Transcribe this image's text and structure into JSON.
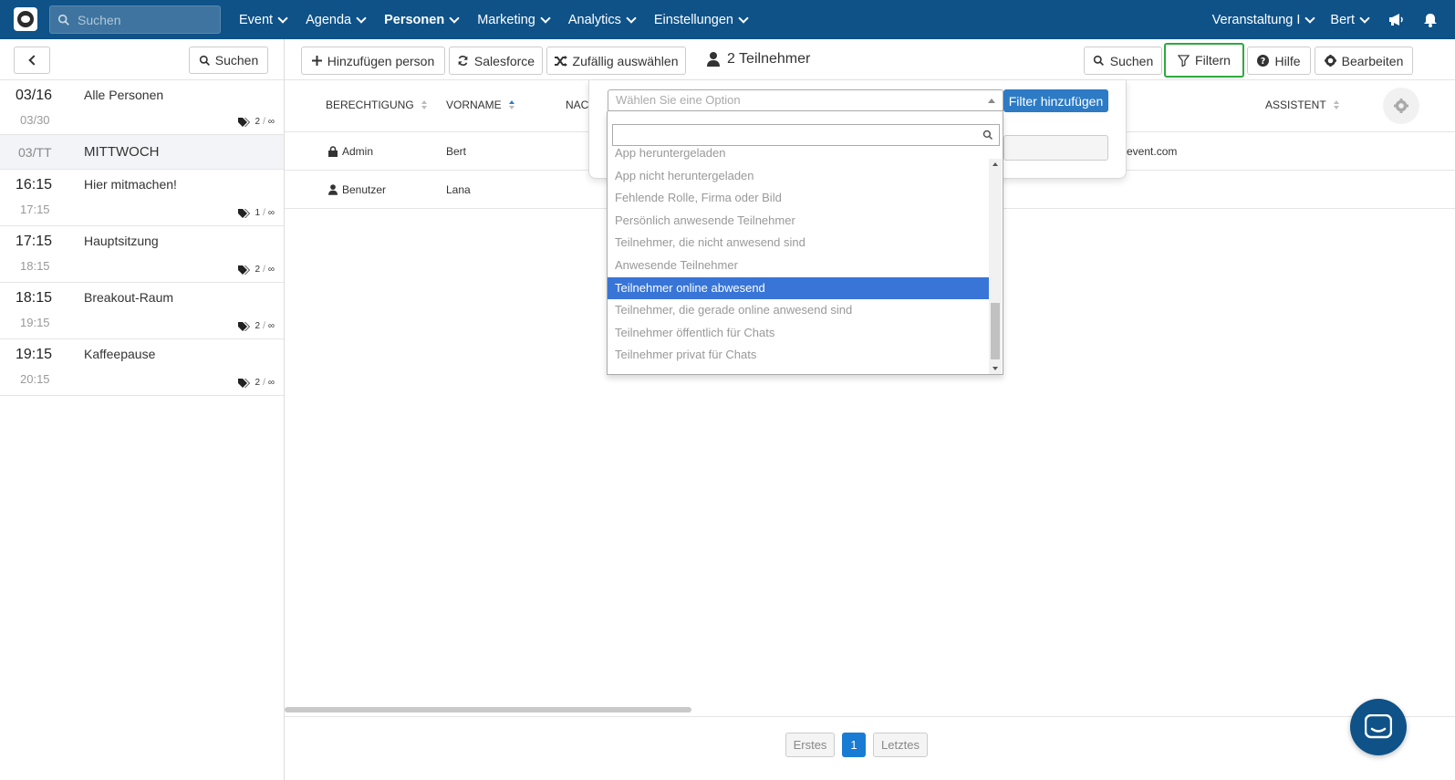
{
  "nav": {
    "search_placeholder": "Suchen",
    "items": [
      {
        "label": "Event",
        "bold": false
      },
      {
        "label": "Agenda",
        "bold": false
      },
      {
        "label": "Personen",
        "bold": true
      },
      {
        "label": "Marketing",
        "bold": false
      },
      {
        "label": "Analytics",
        "bold": false
      },
      {
        "label": "Einstellungen",
        "bold": false
      }
    ],
    "event_selector": "Veranstaltung I",
    "user": "Bert",
    "brand_color": "#0e5288"
  },
  "left": {
    "search_label": "Suchen",
    "sessions": [
      {
        "start": "03/16",
        "end": "03/30",
        "title": "Alle Personen",
        "tag_count": "2",
        "tag_max": "∞",
        "kind": "first"
      },
      {
        "start": "03/TT",
        "title": "MITTWOCH",
        "kind": "day"
      },
      {
        "start": "16:15",
        "end": "17:15",
        "title": "Hier mitmachen!",
        "tag_count": "1",
        "tag_max": "∞",
        "kind": "big"
      },
      {
        "start": "17:15",
        "end": "18:15",
        "title": "Hauptsitzung",
        "tag_count": "2",
        "tag_max": "∞",
        "kind": "big"
      },
      {
        "start": "18:15",
        "end": "19:15",
        "title": "Breakout-Raum",
        "tag_count": "2",
        "tag_max": "∞",
        "kind": "big"
      },
      {
        "start": "19:15",
        "end": "20:15",
        "title": "Kaffeepause",
        "tag_count": "2",
        "tag_max": "∞",
        "kind": "big"
      }
    ]
  },
  "toolbar": {
    "add_person": "Hinzufügen person",
    "salesforce": "Salesforce",
    "random": "Zufällig auswählen",
    "participants_count": "2 Teilnehmer",
    "search": "Suchen",
    "filter": "Filtern",
    "help": "Hilfe",
    "edit": "Bearbeiten",
    "highlight_color": "#2eaa3d"
  },
  "table": {
    "headers": {
      "permission": "BERECHTIGUNG",
      "firstname": "VORNAME",
      "lastname_partial": "NAC",
      "assistant": "ASSISTENT"
    },
    "rows": [
      {
        "permission": "Admin",
        "permission_icon": "lock-icon",
        "firstname": "Bert",
        "email_partial": "event.com"
      },
      {
        "permission": "Benutzer",
        "permission_icon": "user-icon",
        "firstname": "Lana",
        "email_partial": ""
      }
    ]
  },
  "filter_popup": {
    "select_placeholder": "Wählen Sie eine Option",
    "add_button": "Filter hinzufügen",
    "options": [
      "App heruntergeladen",
      "App nicht heruntergeladen",
      "Fehlende Rolle, Firma oder Bild",
      "Persönlich anwesende Teilnehmer",
      "Teilnehmer, die nicht anwesend sind",
      "Anwesende Teilnehmer",
      "Teilnehmer online abwesend",
      "Teilnehmer, die gerade online anwesend sind",
      "Teilnehmer öffentlich für Chats",
      "Teilnehmer privat für Chats"
    ],
    "selected_index": 6,
    "selected_color": "#3875d7"
  },
  "pager": {
    "first": "Erstes",
    "current": "1",
    "last": "Letztes"
  }
}
